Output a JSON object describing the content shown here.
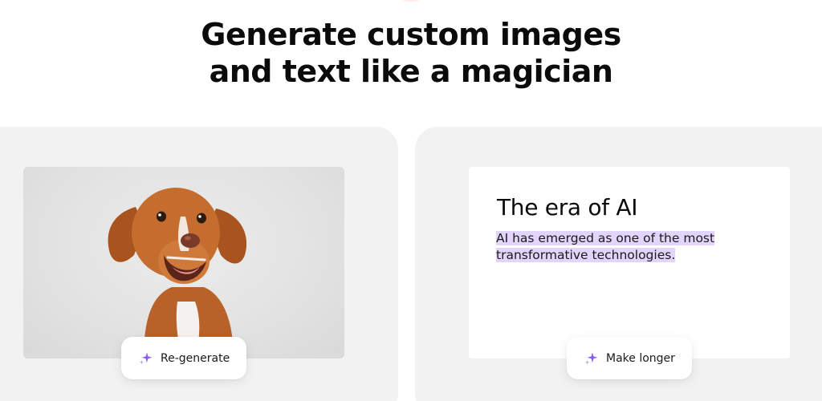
{
  "hero": {
    "headline_line1": "Generate custom images",
    "headline_line2": "and text like a magician"
  },
  "image_card": {
    "image_subject": "dog-photo",
    "action_label": "Re-generate",
    "action_icon": "sparkle-icon"
  },
  "text_card": {
    "title": "The era of AI",
    "body_highlighted": "AI has emerged as one of the most transformative technologies.",
    "highlight_color": "#e3d4fb",
    "action_label": "Make longer",
    "action_icon": "sparkle-icon"
  },
  "colors": {
    "accent": "#8b5cf6",
    "card_bg": "#f2f2f2"
  }
}
